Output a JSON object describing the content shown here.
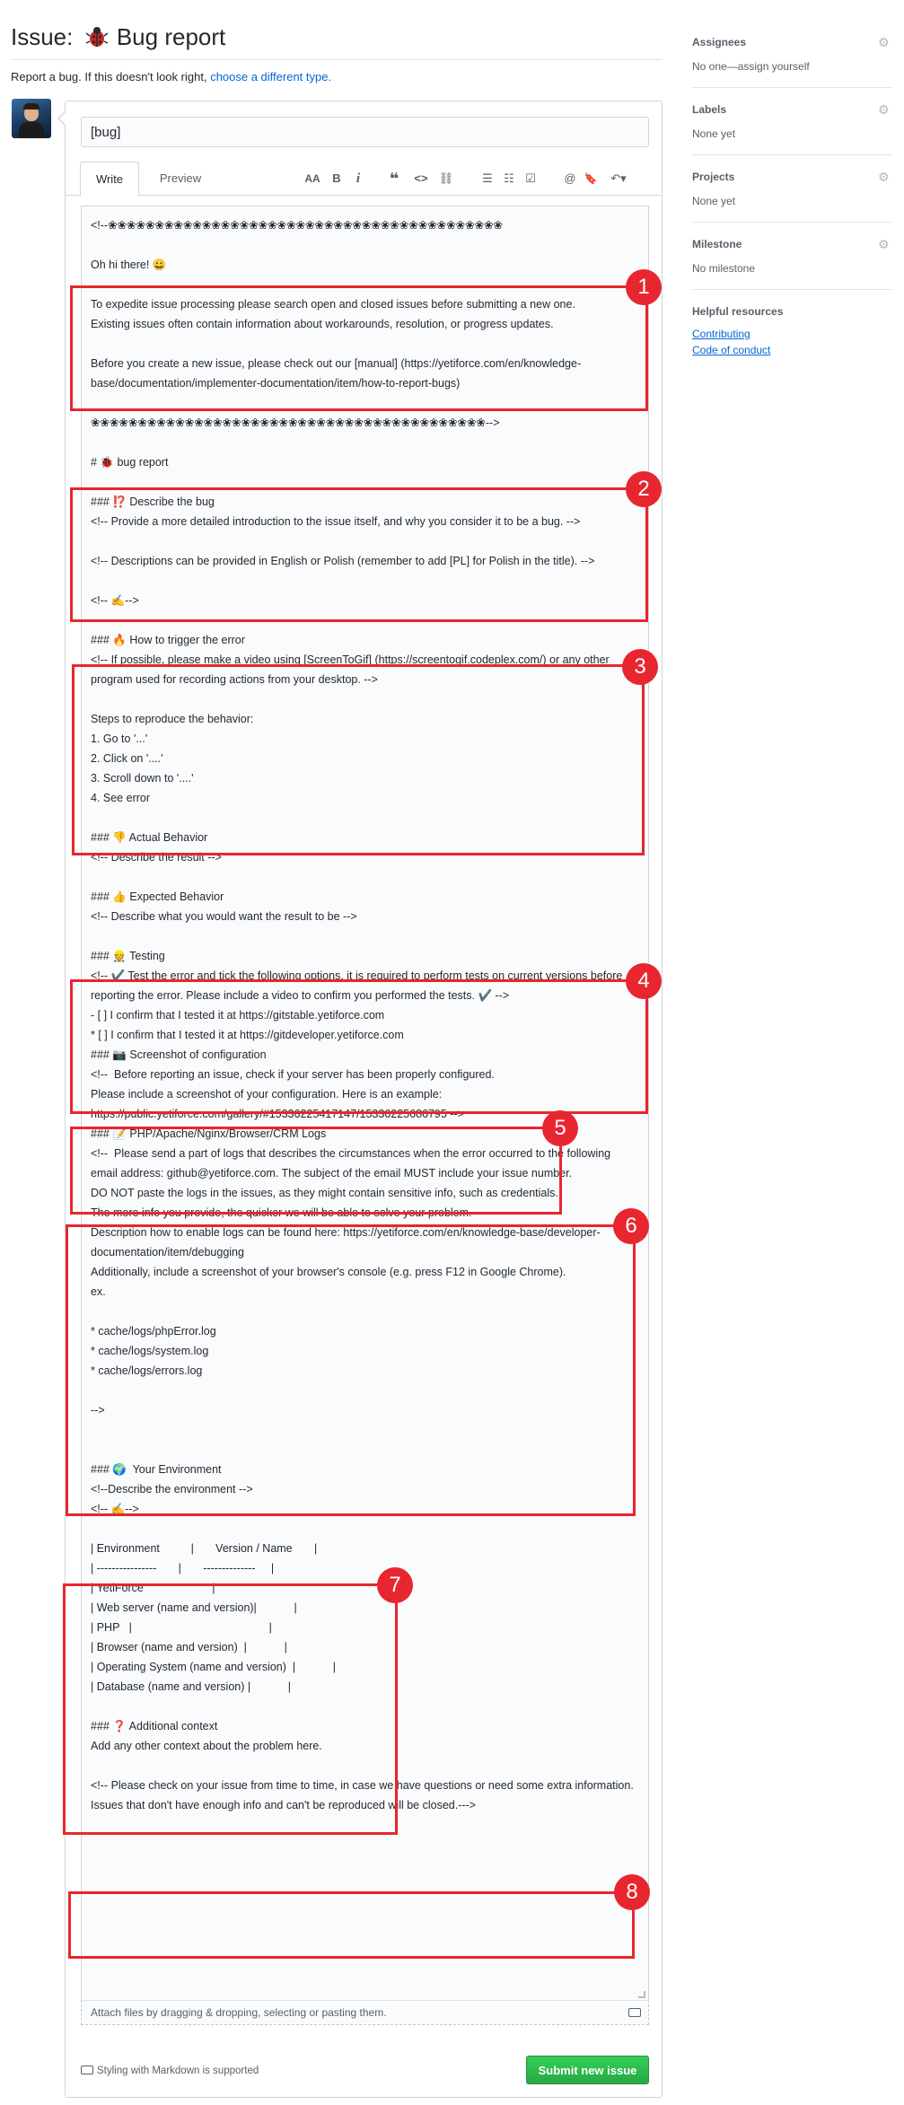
{
  "header": {
    "title_prefix": "Issue:",
    "title_text": "Bug report",
    "subtitle": "Report a bug. If this doesn't look right,",
    "subtitle_link": "choose a different type."
  },
  "form": {
    "title_value": "[bug]",
    "tabs": [
      "Write",
      "Preview"
    ],
    "toolbar": {
      "heading": "AA",
      "bold": "B",
      "italic": "i",
      "quote": "❝",
      "code": "<>",
      "link": "⛓",
      "bullet_list": "☰",
      "numbered_list": "☷",
      "task_list": "☑",
      "mention": "@",
      "saved_reply": "🔖",
      "reply": "↶▾"
    },
    "body": "<!--❀❀❀❀❀❀❀❀❀❀❀❀❀❀❀❀❀❀❀❀❀❀❀❀❀❀❀❀❀❀❀❀❀❀❀❀❀❀❀❀❀❀\n\nOh hi there! 😀\n\nTo expedite issue processing please search open and closed issues before submitting a new one.\nExisting issues often contain information about workarounds, resolution, or progress updates.\n\nBefore you create a new issue, please check out our [manual] (https://yetiforce.com/en/knowledge-base/documentation/implementer-documentation/item/how-to-report-bugs)\n\n❀❀❀❀❀❀❀❀❀❀❀❀❀❀❀❀❀❀❀❀❀❀❀❀❀❀❀❀❀❀❀❀❀❀❀❀❀❀❀❀❀❀-->\n\n# 🐞 bug report\n\n### ⁉️ Describe the bug\n<!-- Provide a more detailed introduction to the issue itself, and why you consider it to be a bug. -->\n\n<!-- Descriptions can be provided in English or Polish (remember to add [PL] for Polish in the title). -->\n\n<!-- ✍️-->\n\n### 🔥 How to trigger the error\n<!-- If possible, please make a video using [ScreenToGif] (https://screentogif.codeplex.com/) or any other program used for recording actions from your desktop. -->\n\nSteps to reproduce the behavior:\n1. Go to '...'\n2. Click on '....'\n3. Scroll down to '....'\n4. See error\n\n### 👎 Actual Behavior\n<!-- Describe the result -->\n\n### 👍 Expected Behavior\n<!-- Describe what you would want the result to be -->\n\n### 👷 Testing\n<!-- ✔️ Test the error and tick the following options, it is required to perform tests on current versions before reporting the error. Please include a video to confirm you performed the tests. ✔️ -->\n- [ ] I confirm that I tested it at https://gitstable.yetiforce.com\n* [ ] I confirm that I tested it at https://gitdeveloper.yetiforce.com\n### 📷 Screenshot of configuration\n<!--  Before reporting an issue, check if your server has been properly configured.\nPlease include a screenshot of your configuration. Here is an example: https://public.yetiforce.com/gallery/#15336225417147/15336225686795 -->\n### 📝 PHP/Apache/Nginx/Browser/CRM Logs\n<!--  Please send a part of logs that describes the circumstances when the error occurred to the following email address: github@yetiforce.com. The subject of the email MUST include your issue number.\nDO NOT paste the logs in the issues, as they might contain sensitive info, such as credentials.\nThe more info you provide, the quicker we will be able to solve your problem.\nDescription how to enable logs can be found here: https://yetiforce.com/en/knowledge-base/developer-documentation/item/debugging\nAdditionally, include a screenshot of your browser's console (e.g. press F12 in Google Chrome).\nex.\n\n* cache/logs/phpError.log\n* cache/logs/system.log\n* cache/logs/errors.log\n\n-->\n\n\n### 🌍  Your Environment\n<!--Describe the environment -->\n<!-- ✍️-->\n\n| Environment          |       Version / Name       |\n| ----------------       |       --------------     |\n| YetiForce                      |\n| Web server (name and version)|            |\n| PHP   |                                            |\n| Browser (name and version)  |            |\n| Operating System (name and version)  |            |\n| Database (name and version) |            |\n\n### ❓ Additional context\nAdd any other context about the problem here.\n\n<!-- Please check on your issue from time to time, in case we have questions or need some extra information. Issues that don't have enough info and can't be reproduced will be closed.--->",
    "attach_hint": "Attach files by dragging & dropping, selecting or pasting them.",
    "markdown_note": "Styling with Markdown is supported",
    "submit_label": "Submit new issue"
  },
  "sidebar": {
    "assignees_heading": "Assignees",
    "assignees_value": "No one—assign yourself",
    "labels_heading": "Labels",
    "labels_value": "None yet",
    "projects_heading": "Projects",
    "projects_value": "None yet",
    "milestone_heading": "Milestone",
    "milestone_value": "No milestone",
    "resources_heading": "Helpful resources",
    "resources_links": [
      "Contributing",
      "Code of conduct"
    ]
  },
  "callouts": [
    "1",
    "2",
    "3",
    "4",
    "5",
    "6",
    "7",
    "8"
  ],
  "colors": {
    "callout": "#e8262f",
    "submit": "#28a745",
    "link": "#0366d6"
  }
}
